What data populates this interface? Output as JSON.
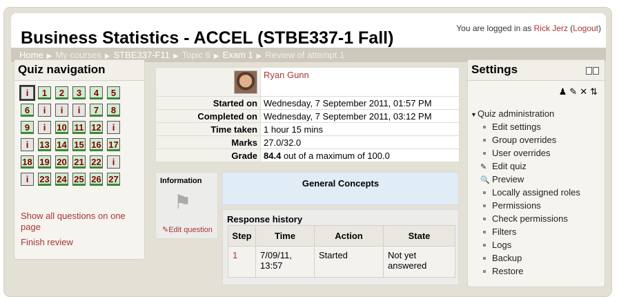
{
  "site": {
    "title": "Business Statistics - ACCEL (STBE337-1 Fall)",
    "login_prefix": "You are logged in as",
    "user": "Rick Jerz",
    "logout": "Logout"
  },
  "breadcrumbs": [
    "Home",
    "My courses",
    "STBE337-F11",
    "Topic 6",
    "Exam 1",
    "Review of attempt 1"
  ],
  "quiz_nav": {
    "title": "Quiz navigation",
    "buttons": [
      "i",
      "1",
      "2",
      "3",
      "4",
      "5",
      "6",
      "i",
      "i",
      "i",
      "7",
      "8",
      "9",
      "i",
      "10",
      "11",
      "12",
      "i",
      "i",
      "13",
      "14",
      "15",
      "16",
      "17",
      "18",
      "19",
      "20",
      "21",
      "22",
      "i",
      "i",
      "23",
      "24",
      "25",
      "26",
      "27"
    ],
    "show_all": "Show all questions on one page",
    "finish": "Finish review"
  },
  "summary": {
    "user_name": "Ryan Gunn",
    "rows": [
      {
        "label": "Started on",
        "value": "Wednesday, 7 September 2011, 01:57 PM"
      },
      {
        "label": "Completed on",
        "value": "Wednesday, 7 September 2011, 03:12 PM"
      },
      {
        "label": "Time taken",
        "value": "1 hour 15 mins"
      },
      {
        "label": "Marks",
        "value": "27.0/32.0"
      }
    ],
    "grade_label": "Grade",
    "grade_value": "84.4",
    "grade_suffix": "out of a maximum of 100.0"
  },
  "info_box": {
    "title": "Information",
    "edit": "Edit question"
  },
  "question_title": "General Concepts",
  "response_history": {
    "title": "Response history",
    "headers": [
      "Step",
      "Time",
      "Action",
      "State"
    ],
    "rows": [
      {
        "step": "1",
        "time": "7/09/11, 13:57",
        "action": "Started",
        "state": "Not yet answered"
      }
    ]
  },
  "settings": {
    "title": "Settings",
    "root": "Quiz administration",
    "items": [
      "Edit settings",
      "Group overrides",
      "User overrides",
      "Edit quiz",
      "Preview",
      "Locally assigned roles",
      "Permissions",
      "Check permissions",
      "Filters",
      "Logs",
      "Backup",
      "Restore"
    ]
  }
}
